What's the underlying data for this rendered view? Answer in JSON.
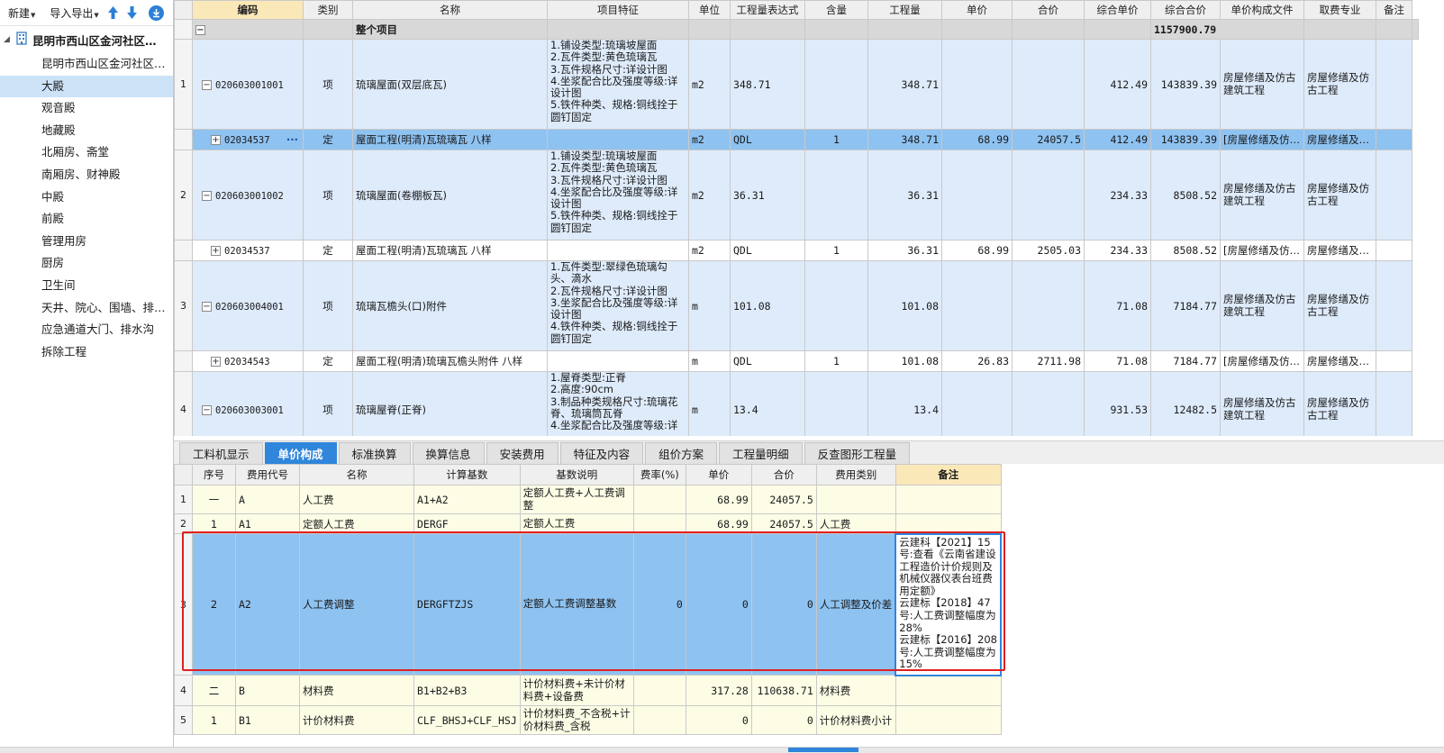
{
  "toolbar": {
    "new_label": "新建",
    "import_label": "导入导出"
  },
  "tree": {
    "root": "昆明市西山区金河社区…",
    "items": [
      {
        "label": "昆明市西山区金河社区…",
        "selected": false
      },
      {
        "label": "大殿",
        "selected": true
      },
      {
        "label": "观音殿",
        "selected": false
      },
      {
        "label": "地藏殿",
        "selected": false
      },
      {
        "label": "北厢房、斋堂",
        "selected": false
      },
      {
        "label": "南厢房、财神殿",
        "selected": false
      },
      {
        "label": "中殿",
        "selected": false
      },
      {
        "label": "前殿",
        "selected": false
      },
      {
        "label": "管理用房",
        "selected": false
      },
      {
        "label": "厨房",
        "selected": false
      },
      {
        "label": "卫生间",
        "selected": false
      },
      {
        "label": "天井、院心、围墙、排…",
        "selected": false
      },
      {
        "label": "应急通道大门、排水沟",
        "selected": false
      },
      {
        "label": "拆除工程",
        "selected": false
      }
    ]
  },
  "grid": {
    "headers": [
      "编码",
      "类别",
      "名称",
      "项目特征",
      "单位",
      "工程量表达式",
      "含量",
      "工程量",
      "单价",
      "合价",
      "综合单价",
      "综合合价",
      "单价构成文件",
      "取费专业",
      "备注"
    ],
    "whole": {
      "label": "整个项目",
      "total": "1157900.79"
    },
    "rows": [
      {
        "kind": "item",
        "idx": "1",
        "code": "020603001001",
        "type": "项",
        "name": "琉璃屋面(双层底瓦)",
        "feature": "1.铺设类型:琉璃坡屋面\n2.瓦件类型:黄色琉璃瓦\n3.瓦件规格尺寸:详设计图\n4.坐浆配合比及强度等级:详设计图\n5.铁件种类、规格:铜线拴于圆钉固定",
        "unit": "m2",
        "expr": "348.71",
        "content": "",
        "qty": "348.71",
        "price": "",
        "amount": "",
        "uprice": "412.49",
        "uamount": "143839.39",
        "file": "房屋修缮及仿古建筑工程",
        "prof": "房屋修缮及仿古工程",
        "h": 100
      },
      {
        "kind": "subsel",
        "idx": "",
        "code": "02034537",
        "type": "定",
        "name": "屋面工程(明清)瓦琉璃瓦 八样",
        "feature": "",
        "unit": "m2",
        "expr": "QDL",
        "content": "1",
        "qty": "348.71",
        "price": "68.99",
        "amount": "24057.5",
        "uprice": "412.49",
        "uamount": "143839.39",
        "file": "[房屋修缮及仿…",
        "prof": "房屋修缮及…",
        "h": 23
      },
      {
        "kind": "item",
        "idx": "2",
        "code": "020603001002",
        "type": "项",
        "name": "琉璃屋面(卷棚板瓦)",
        "feature": "1.铺设类型:琉璃坡屋面\n2.瓦件类型:黄色琉璃瓦\n3.瓦件规格尺寸:详设计图\n4.坐浆配合比及强度等级:详设计图\n5.铁件种类、规格:铜线拴于圆钉固定",
        "unit": "m2",
        "expr": "36.31",
        "content": "",
        "qty": "36.31",
        "price": "",
        "amount": "",
        "uprice": "234.33",
        "uamount": "8508.52",
        "file": "房屋修缮及仿古建筑工程",
        "prof": "房屋修缮及仿古工程",
        "h": 100
      },
      {
        "kind": "sub",
        "idx": "",
        "code": "02034537",
        "type": "定",
        "name": "屋面工程(明清)瓦琉璃瓦 八样",
        "feature": "",
        "unit": "m2",
        "expr": "QDL",
        "content": "1",
        "qty": "36.31",
        "price": "68.99",
        "amount": "2505.03",
        "uprice": "234.33",
        "uamount": "8508.52",
        "file": "[房屋修缮及仿…",
        "prof": "房屋修缮及…",
        "h": 23
      },
      {
        "kind": "item",
        "idx": "3",
        "code": "020603004001",
        "type": "项",
        "name": "琉璃瓦檐头(口)附件",
        "feature": "1.瓦件类型:翠绿色琉璃勾头、滴水\n2.瓦件规格尺寸:详设计图\n3.坐浆配合比及强度等级:详设计图\n4.铁件种类、规格:铜线拴于圆钉固定",
        "unit": "m",
        "expr": "101.08",
        "content": "",
        "qty": "101.08",
        "price": "",
        "amount": "",
        "uprice": "71.08",
        "uamount": "7184.77",
        "file": "房屋修缮及仿古建筑工程",
        "prof": "房屋修缮及仿古工程",
        "h": 100
      },
      {
        "kind": "sub",
        "idx": "",
        "code": "02034543",
        "type": "定",
        "name": "屋面工程(明清)琉璃瓦檐头附件 八样",
        "feature": "",
        "unit": "m",
        "expr": "QDL",
        "content": "1",
        "qty": "101.08",
        "price": "26.83",
        "amount": "2711.98",
        "uprice": "71.08",
        "uamount": "7184.77",
        "file": "[房屋修缮及仿…",
        "prof": "房屋修缮及…",
        "h": 23
      },
      {
        "kind": "item",
        "idx": "4",
        "code": "020603003001",
        "type": "项",
        "name": "琉璃屋脊(正脊)",
        "feature": "1.屋脊类型:正脊\n2.高度:90cm\n3.制品种类规格尺寸:琉璃花脊、琉璃筒瓦脊\n4.坐浆配合比及强度等级:详",
        "unit": "m",
        "expr": "13.4",
        "content": "",
        "qty": "13.4",
        "price": "",
        "amount": "",
        "uprice": "931.53",
        "uamount": "12482.5",
        "file": "房屋修缮及仿古建筑工程",
        "prof": "房屋修缮及仿古工程",
        "h": 84
      }
    ]
  },
  "tabs": [
    {
      "label": "工料机显示",
      "active": false
    },
    {
      "label": "单价构成",
      "active": true
    },
    {
      "label": "标准换算",
      "active": false
    },
    {
      "label": "换算信息",
      "active": false
    },
    {
      "label": "安装费用",
      "active": false
    },
    {
      "label": "特征及内容",
      "active": false
    },
    {
      "label": "组价方案",
      "active": false
    },
    {
      "label": "工程量明细",
      "active": false
    },
    {
      "label": "反查图形工程量",
      "active": false
    }
  ],
  "sub": {
    "headers": [
      "序号",
      "费用代号",
      "名称",
      "计算基数",
      "基数说明",
      "费率(%)",
      "单价",
      "合价",
      "费用类别",
      "备注"
    ],
    "rows": [
      {
        "idx": "1",
        "seq": "一",
        "code": "A",
        "name": "人工费",
        "base": "A1+A2",
        "desc": "定额人工费+人工费调整",
        "rate": "",
        "price": "68.99",
        "amount": "24057.5",
        "cat": "",
        "note": "",
        "h": 32
      },
      {
        "idx": "2",
        "seq": "1",
        "code": "A1",
        "name": "定额人工费",
        "base": "DERGF",
        "desc": "定额人工费",
        "rate": "",
        "price": "68.99",
        "amount": "24057.5",
        "cat": "人工费",
        "note": "",
        "h": 22
      },
      {
        "idx": "3",
        "seq": "2",
        "code": "A2",
        "name": "人工费调整",
        "base": "DERGFTZJS",
        "desc": "定额人工费调整基数",
        "rate": "0",
        "price": "0",
        "amount": "0",
        "cat": "人工调整及价差",
        "note": "云建科【2021】15号:查看《云南省建设工程造价计价规则及机械仪器仪表台班费用定额》\n云建标【2018】47号:人工费调整幅度为28%\n云建标【2016】208号:人工费调整幅度为15%",
        "h": 157
      },
      {
        "idx": "4",
        "seq": "二",
        "code": "B",
        "name": "材料费",
        "base": "B1+B2+B3",
        "desc": "计价材料费+未计价材料费+设备费",
        "rate": "",
        "price": "317.28",
        "amount": "110638.71",
        "cat": "材料费",
        "note": "",
        "h": 34
      },
      {
        "idx": "5",
        "seq": "1",
        "code": "B1",
        "name": "计价材料费",
        "base": "CLF_BHSJ+CLF_HSJ",
        "desc": "计价材料费_不含税+计价材料费_含税",
        "rate": "",
        "price": "0",
        "amount": "0",
        "cat": "计价材料费小计",
        "note": "",
        "h": 32
      }
    ]
  },
  "colors": {
    "accent": "#2f86db",
    "selected_row": "#8ec2f1",
    "item_row": "#deebfb",
    "highlight_box": "#e02020"
  }
}
